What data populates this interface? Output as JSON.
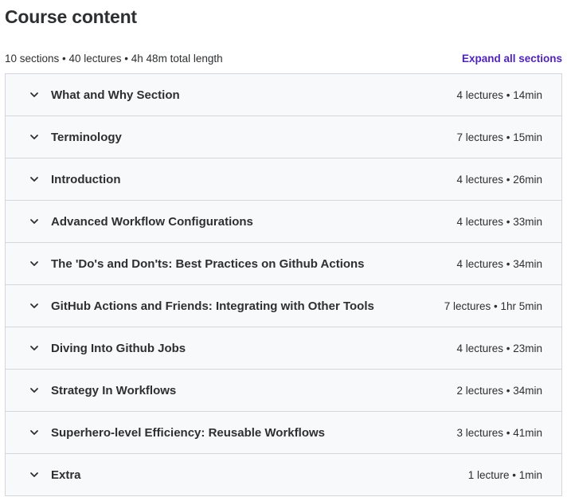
{
  "header": {
    "title": "Course content",
    "summary": "10 sections • 40 lectures • 4h 48m total length",
    "expand_all_label": "Expand all sections"
  },
  "icons": {
    "chevron": "chevron-down-icon"
  },
  "colors": {
    "accent": "#5022c3",
    "row_background": "#f7f9fa",
    "border": "#d1d7dc",
    "text": "#2d2f31"
  },
  "sections": [
    {
      "title": "What and Why Section",
      "meta": "4 lectures • 14min"
    },
    {
      "title": "Terminology",
      "meta": "7 lectures • 15min"
    },
    {
      "title": "Introduction",
      "meta": "4 lectures • 26min"
    },
    {
      "title": "Advanced Workflow Configurations",
      "meta": "4 lectures • 33min"
    },
    {
      "title": "The 'Do's and Don'ts: Best Practices on Github Actions",
      "meta": "4 lectures • 34min"
    },
    {
      "title": "GitHub Actions and Friends: Integrating with Other Tools",
      "meta": "7 lectures • 1hr 5min"
    },
    {
      "title": "Diving Into Github Jobs",
      "meta": "4 lectures • 23min"
    },
    {
      "title": "Strategy In Workflows",
      "meta": "2 lectures • 34min"
    },
    {
      "title": "Superhero-level Efficiency: Reusable Workflows",
      "meta": "3 lectures • 41min"
    },
    {
      "title": "Extra",
      "meta": "1 lecture • 1min"
    }
  ]
}
